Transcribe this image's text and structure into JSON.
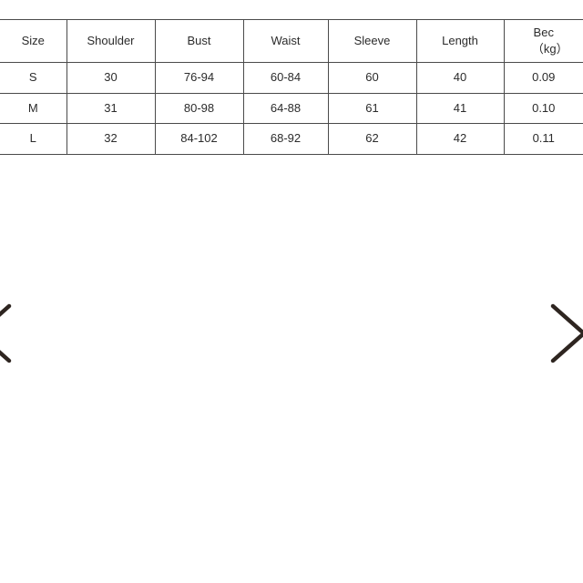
{
  "page": {
    "background_color": "#ffffff",
    "text_color": "#2b2b2b",
    "border_color": "#4a4a4a"
  },
  "size_chart": {
    "columns": [
      {
        "label": "Size",
        "sublabel": ""
      },
      {
        "label": "Shoulder",
        "sublabel": ""
      },
      {
        "label": "Bust",
        "sublabel": ""
      },
      {
        "label": "Waist",
        "sublabel": ""
      },
      {
        "label": "Sleeve",
        "sublabel": ""
      },
      {
        "label": "Length",
        "sublabel": ""
      },
      {
        "label": "Bec",
        "sublabel": "（kg）"
      }
    ],
    "rows": [
      {
        "size": "S",
        "shoulder": "30",
        "bust": "76-94",
        "waist": "60-84",
        "sleeve": "60",
        "length": "40",
        "bec": "0.09"
      },
      {
        "size": "M",
        "shoulder": "31",
        "bust": "80-98",
        "waist": "64-88",
        "sleeve": "61",
        "length": "41",
        "bec": "0.10"
      },
      {
        "size": "L",
        "shoulder": "32",
        "bust": "84-102",
        "waist": "68-92",
        "sleeve": "62",
        "length": "42",
        "bec": "0.11"
      }
    ]
  },
  "carousel": {
    "prev_icon": "chevron-left-icon",
    "next_icon": "chevron-right-icon",
    "stroke_color": "#2e2520"
  }
}
